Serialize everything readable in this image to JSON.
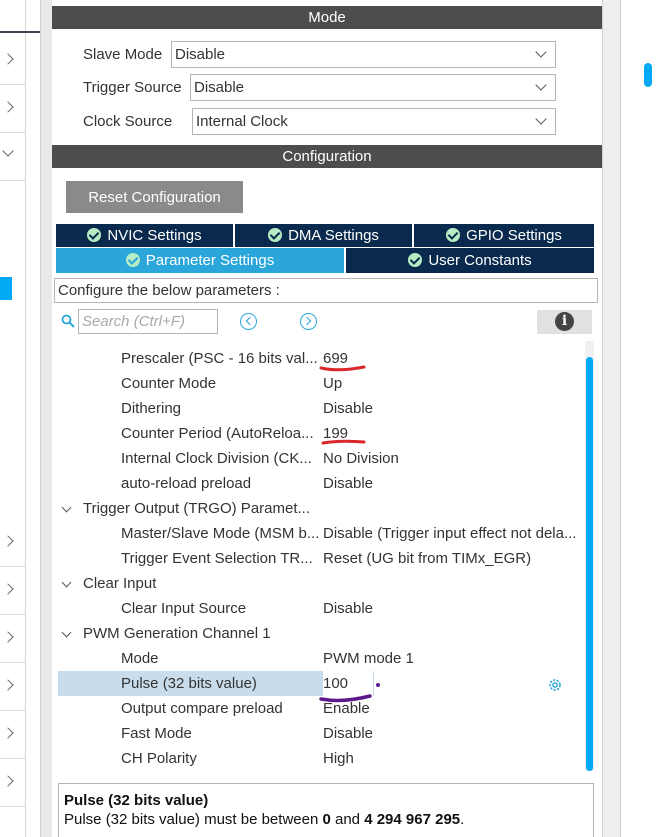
{
  "mode": {
    "title": "Mode",
    "fields": [
      {
        "label": "Slave Mode",
        "value": "Disable"
      },
      {
        "label": "Trigger Source",
        "value": "Disable"
      },
      {
        "label": "Clock Source",
        "value": "Internal Clock"
      }
    ]
  },
  "configuration": {
    "title": "Configuration",
    "reset_label": "Reset Configuration",
    "tabs_top": [
      "NVIC Settings",
      "DMA Settings",
      "GPIO Settings"
    ],
    "tabs_bottom": [
      "Parameter Settings",
      "User Constants"
    ],
    "active_tab": "Parameter Settings",
    "configure_text": "Configure the below parameters :",
    "search_placeholder": "Search (Ctrl+F)"
  },
  "parameters": [
    {
      "name": "Prescaler (PSC - 16 bits val...",
      "value": "699"
    },
    {
      "name": "Counter Mode",
      "value": "Up"
    },
    {
      "name": "Dithering",
      "value": "Disable"
    },
    {
      "name": "Counter Period (AutoReloa...",
      "value": "199"
    },
    {
      "name": "Internal Clock Division (CK...",
      "value": "No Division"
    },
    {
      "name": "auto-reload preload",
      "value": "Disable"
    },
    {
      "name": "Trigger Output (TRGO) Paramet...",
      "value": "",
      "group": true
    },
    {
      "name": "Master/Slave Mode (MSM b...",
      "value": "Disable (Trigger input effect not dela..."
    },
    {
      "name": "Trigger Event Selection TR...",
      "value": "Reset (UG bit from TIMx_EGR)"
    },
    {
      "name": "Clear Input",
      "value": "",
      "group": true
    },
    {
      "name": "Clear Input Source",
      "value": "Disable"
    },
    {
      "name": "PWM Generation Channel 1",
      "value": "",
      "group": true
    },
    {
      "name": "Mode",
      "value": "PWM mode 1"
    },
    {
      "name": "Pulse (32 bits value)",
      "value": "100",
      "selected": true
    },
    {
      "name": "Output compare preload",
      "value": "Enable"
    },
    {
      "name": "Fast Mode",
      "value": "Disable"
    },
    {
      "name": "CH Polarity",
      "value": "High"
    }
  ],
  "description": {
    "title": "Pulse (32 bits value)",
    "text_prefix": "Pulse (32 bits value) must be between ",
    "min": "0",
    "text_mid": " and ",
    "max": "4 294 967 295",
    "text_suffix": "."
  },
  "colors": {
    "accent": "#2aa6da",
    "tab_dark": "#0a2a4d",
    "header": "#4d4d4d",
    "annotation_red": "#d8262b",
    "annotation_purple": "#6a1b9a"
  }
}
